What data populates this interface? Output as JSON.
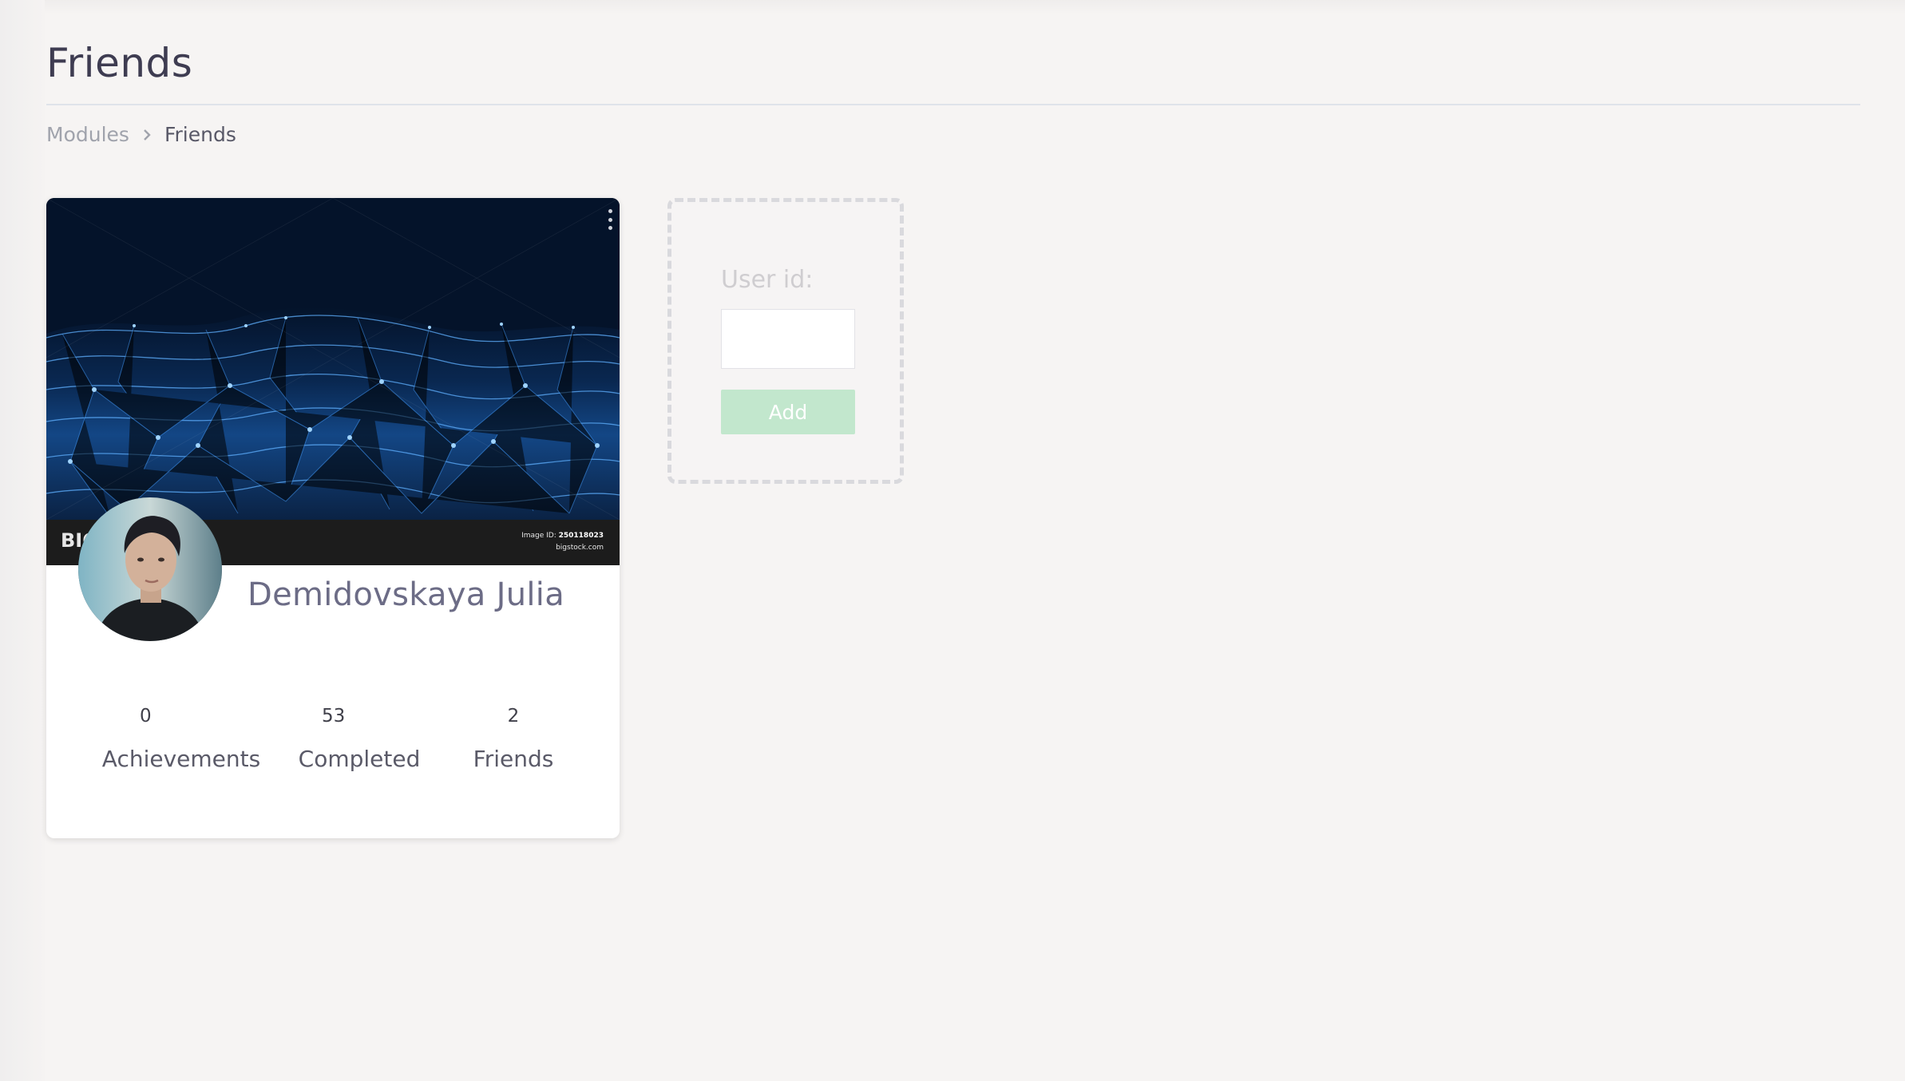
{
  "page": {
    "title": "Friends"
  },
  "breadcrumb": {
    "items": [
      "Modules",
      "Friends"
    ]
  },
  "profile_card": {
    "name": "Demidovskaya Julia",
    "cover_image": {
      "brand": "BIGSTOCK",
      "brand_short": "BIG",
      "image_id_label": "Image ID:",
      "image_id": "250118023",
      "site": "bigstock.com"
    },
    "stats": [
      {
        "value": "0",
        "label": "Achievements"
      },
      {
        "value": "53",
        "label": "Completed"
      },
      {
        "value": "2",
        "label": "Friends"
      }
    ]
  },
  "add_friend": {
    "label": "User id:",
    "input_value": "",
    "button_label": "Add"
  },
  "colors": {
    "background": "#f6f4f3",
    "card": "#ffffff",
    "title": "#3e3c51",
    "name": "#6c6c86",
    "add_button": "#c2e7cd",
    "cover": "#04132a"
  },
  "icons": [
    "chevron-right-icon",
    "kebab-menu-icon"
  ]
}
